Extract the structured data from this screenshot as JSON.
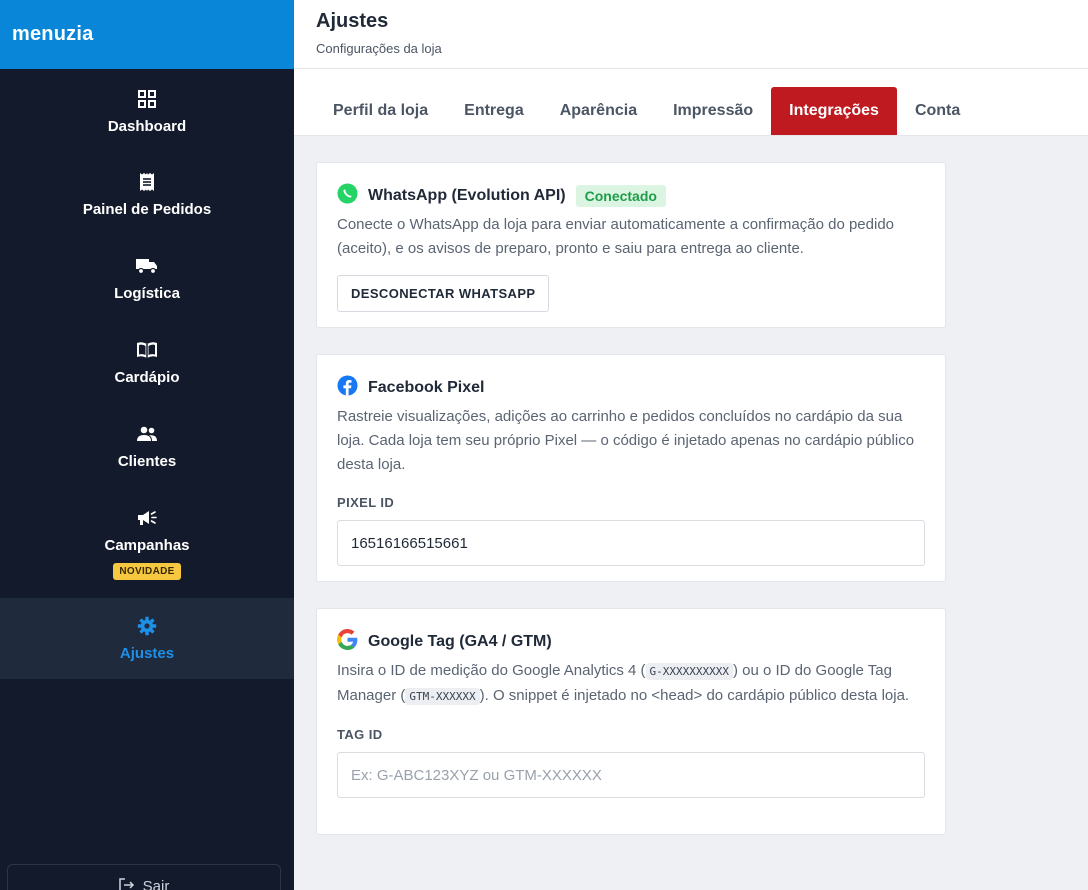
{
  "brand": "menuzia",
  "sidebar": {
    "items": [
      {
        "label": "Dashboard",
        "icon": "grid-icon"
      },
      {
        "label": "Painel de Pedidos",
        "icon": "receipt-icon"
      },
      {
        "label": "Logística",
        "icon": "truck-icon"
      },
      {
        "label": "Cardápio",
        "icon": "book-icon"
      },
      {
        "label": "Clientes",
        "icon": "users-icon"
      },
      {
        "label": "Campanhas",
        "icon": "megaphone-icon",
        "badge": "NOVIDADE"
      },
      {
        "label": "Ajustes",
        "icon": "gear-icon",
        "active": true
      }
    ],
    "logout": "Sair"
  },
  "header": {
    "title": "Ajustes",
    "subtitle": "Configurações da loja"
  },
  "tabs": [
    "Perfil da loja",
    "Entrega",
    "Aparência",
    "Impressão",
    "Integrações",
    "Conta"
  ],
  "active_tab": "Integrações",
  "whatsapp": {
    "title": "WhatsApp (Evolution API)",
    "status": "Conectado",
    "description": "Conecte o WhatsApp da loja para enviar automaticamente a confirmação do pedido (aceito), e os avisos de preparo, pronto e saiu para entrega ao cliente.",
    "button": "DESCONECTAR WHATSAPP"
  },
  "facebook": {
    "title": "Facebook Pixel",
    "description": "Rastreie visualizações, adições ao carrinho e pedidos concluídos no cardápio da sua loja. Cada loja tem seu próprio Pixel — o código é injetado apenas no cardápio público desta loja.",
    "field_label": "PIXEL ID",
    "field_value": "16516166515661"
  },
  "google": {
    "title": "Google Tag (GA4 / GTM)",
    "desc_part1": "Insira o ID de medição do Google Analytics 4 (",
    "code1": "G-XXXXXXXXXX",
    "desc_part2": ") ou o ID do Google Tag Manager (",
    "code2": "GTM-XXXXXX",
    "desc_part3": "). O snippet é injetado no <head> do cardápio público desta loja.",
    "field_label": "TAG ID",
    "field_placeholder": "Ex: G-ABC123XYZ ou GTM-XXXXXX"
  },
  "colors": {
    "brand": "#0a86d8",
    "sidebar": "#131a2b",
    "active_tab": "#be1a1f",
    "connected": "#1f9d49"
  }
}
